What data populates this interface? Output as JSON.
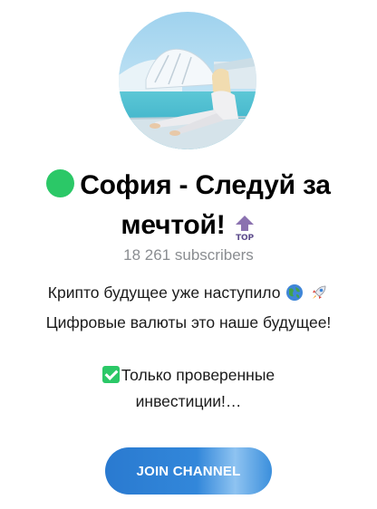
{
  "channel": {
    "title": "София - Следуй за мечтой!",
    "subscribers": "18 261 subscribers",
    "description": {
      "line1": "Крипто будущее уже наступило",
      "line2": "Цифровые валюты это наше будущее!",
      "line3": "Только проверенные",
      "line4": "инвестиции!…"
    },
    "join_label": "JOIN CHANNEL",
    "status_color": "#2bc867",
    "button_color": "#2a7ad0"
  },
  "icons": {
    "status": "green-circle-icon",
    "top_badge": "top-arrow-icon",
    "globe": "globe-icon",
    "rocket": "rocket-icon",
    "check": "check-mark-icon"
  }
}
